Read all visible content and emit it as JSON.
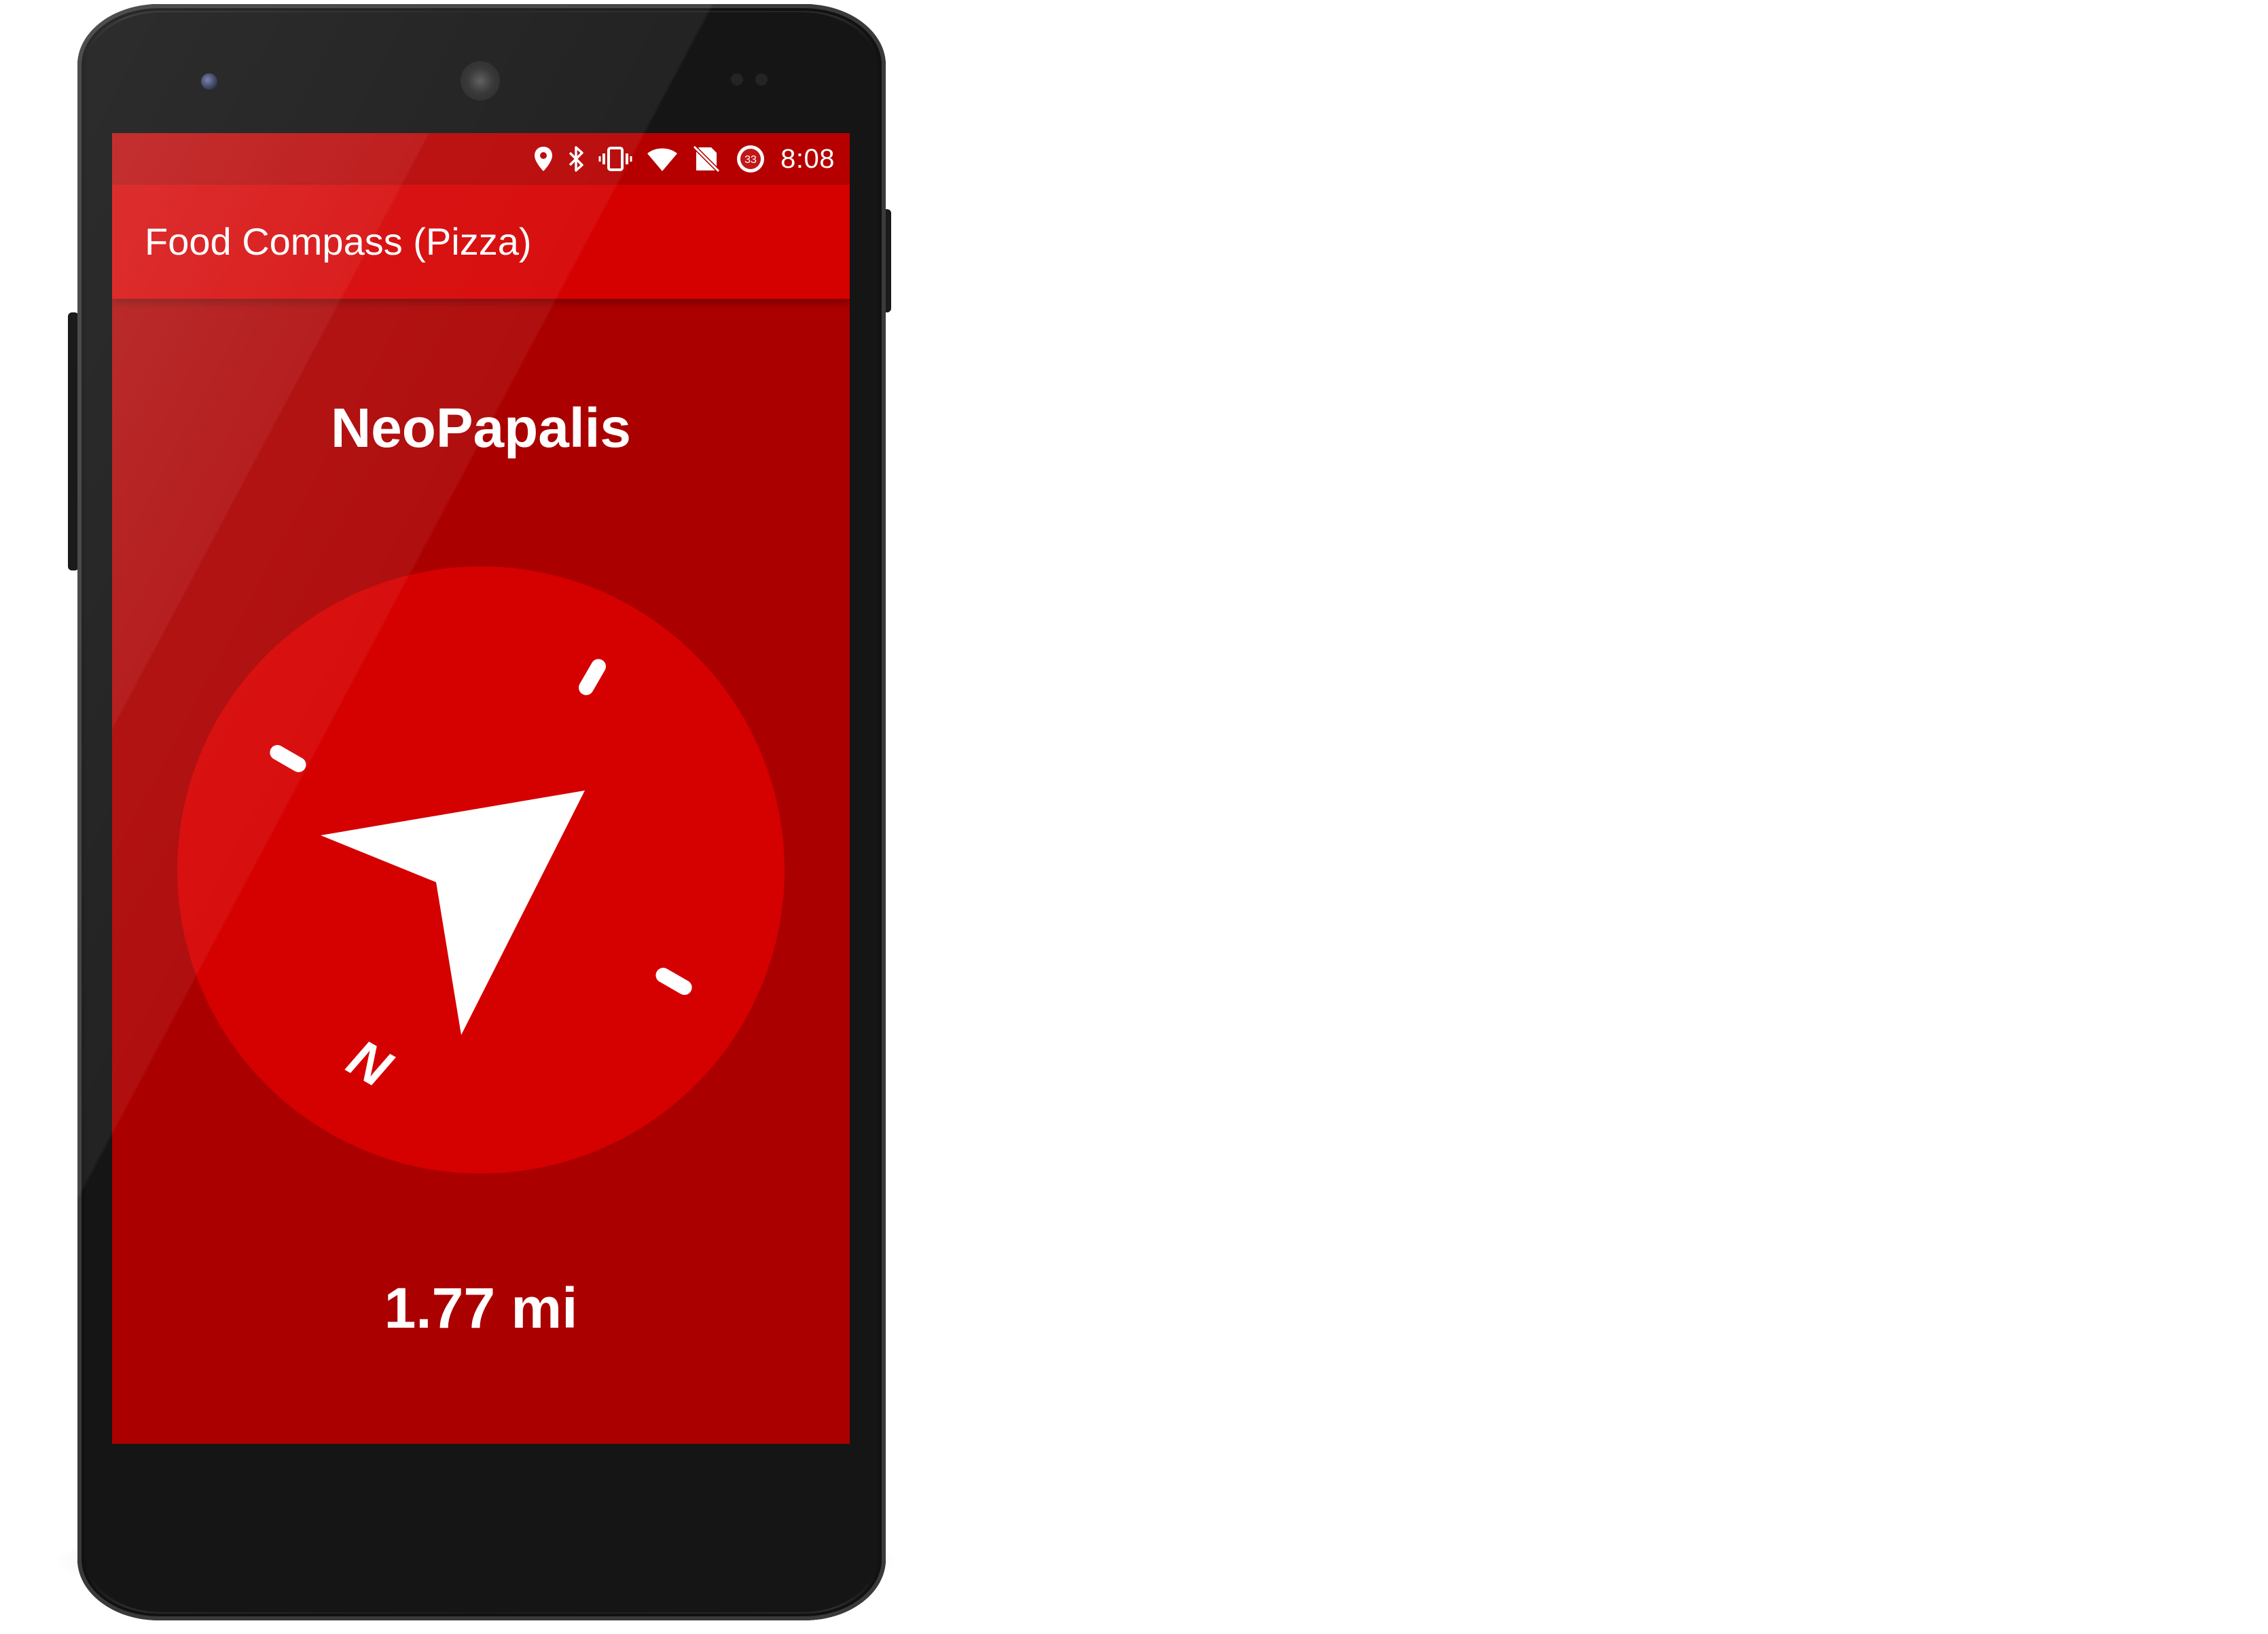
{
  "status_bar": {
    "time": "8:08",
    "icons": [
      "location-pin-icon",
      "bluetooth-icon",
      "vibrate-icon",
      "wifi-icon",
      "no-sim-icon",
      "battery-saver-icon"
    ],
    "battery_badge": "33"
  },
  "app_bar": {
    "title": "Food Compass (Pizza)"
  },
  "main": {
    "place_name": "NeoPapalis",
    "distance": "1.77 mi",
    "compass": {
      "north_label": "N",
      "colors": {
        "dial": "#d50000",
        "marks": "#ffffff",
        "background": "#ab0000"
      }
    }
  },
  "colors": {
    "status_bar": "#b60000",
    "app_bar": "#d50000",
    "screen": "#ab0000"
  }
}
